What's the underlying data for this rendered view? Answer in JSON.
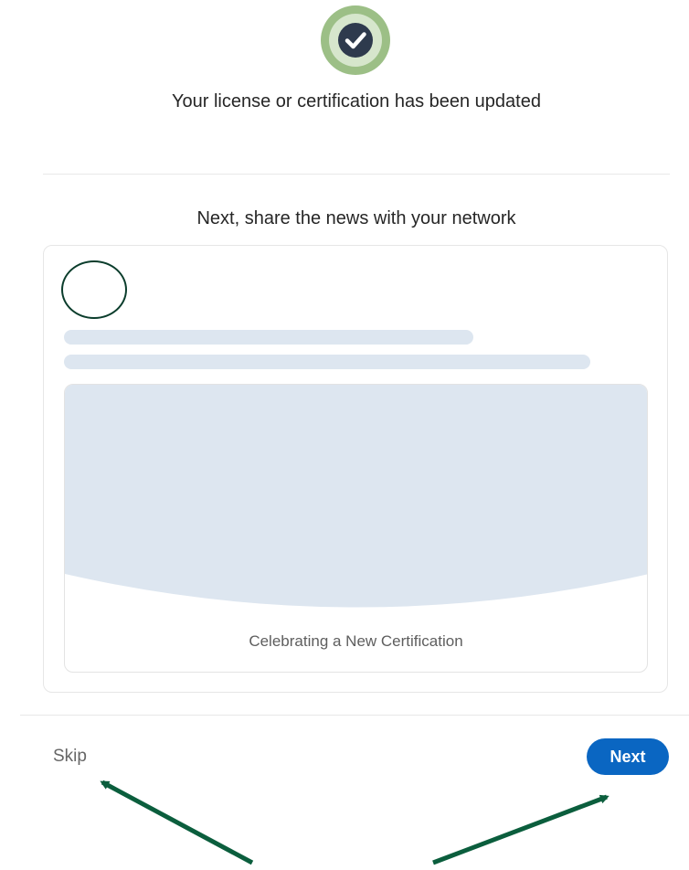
{
  "success": {
    "icon": "checkmark-circle-icon",
    "message": "Your license or certification has been updated"
  },
  "share": {
    "heading": "Next, share the news with your network",
    "preview": {
      "media_caption": "Celebrating a New Certification"
    }
  },
  "footer": {
    "skip_label": "Skip",
    "next_label": "Next"
  },
  "colors": {
    "accent": "#0a66c2",
    "success_ring": "#9cbf86",
    "annotation": "#0b5e3d",
    "skeleton": "#dde6f0"
  }
}
